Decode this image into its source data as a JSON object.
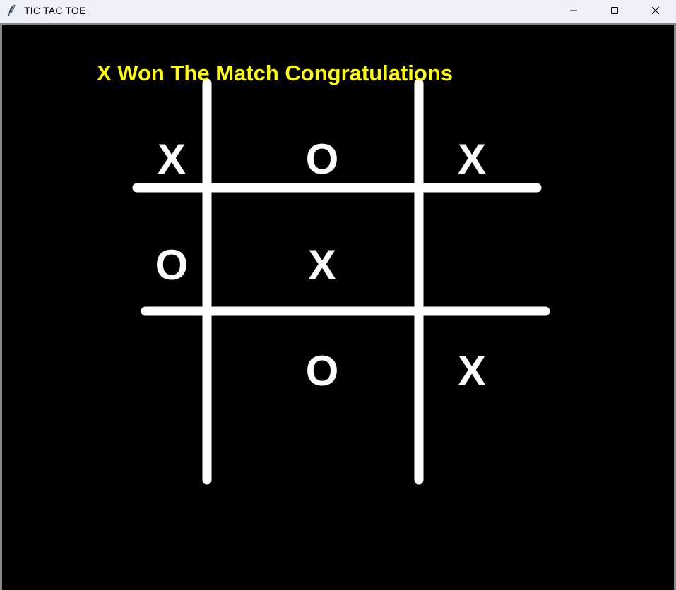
{
  "window": {
    "title": "TIC TAC TOE",
    "controls": [
      "minimize-icon",
      "maximize-icon",
      "close-icon"
    ]
  },
  "game": {
    "message": "X Won The Match Congratulations",
    "message_color": "#ffff00",
    "background": "#000000",
    "line_color": "#ffffff",
    "board": [
      [
        "X",
        "O",
        "X"
      ],
      [
        "O",
        "X",
        ""
      ],
      [
        "",
        "O",
        "X"
      ]
    ]
  }
}
